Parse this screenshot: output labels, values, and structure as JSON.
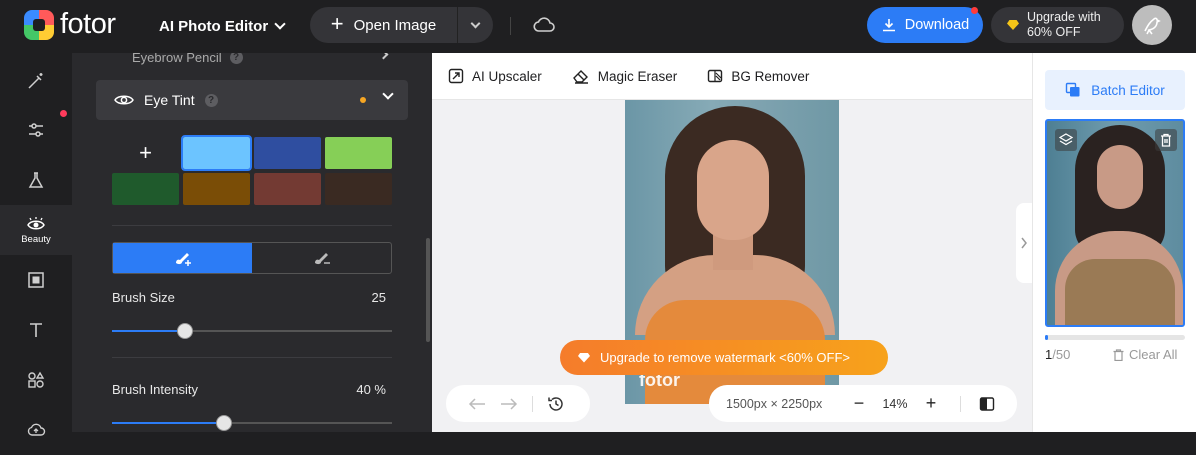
{
  "app": {
    "logo_text": "fotor",
    "menu_title": "AI Photo Editor",
    "open_image_label": "Open Image",
    "download_label": "Download",
    "upgrade_line1": "Upgrade with",
    "upgrade_line2": "60% OFF"
  },
  "rail": {
    "items": [
      {
        "icon": "magic-wand-icon",
        "label": ""
      },
      {
        "icon": "adjust-sliders-icon",
        "label": ""
      },
      {
        "icon": "flask-effects-icon",
        "label": ""
      },
      {
        "icon": "eye-beauty-icon",
        "label": "Beauty",
        "active": true
      },
      {
        "icon": "frame-icon",
        "label": ""
      },
      {
        "icon": "text-icon",
        "label": ""
      },
      {
        "icon": "elements-shapes-icon",
        "label": ""
      },
      {
        "icon": "cloud-upload-icon",
        "label": ""
      }
    ]
  },
  "panel": {
    "prev_section_label": "Eyebrow Pencil",
    "section_title": "Eye Tint",
    "add_label": "+",
    "swatches": [
      "#6cc4ff",
      "#2f4ea0",
      "#86cf57",
      "#1f5a2c",
      "#7a4d06",
      "#733a33",
      "#3a2a22"
    ],
    "selected_swatch": "#6cc4ff",
    "brush_size_label": "Brush Size",
    "brush_size_value": "25",
    "brush_size_fraction": 0.26,
    "brush_intensity_label": "Brush Intensity",
    "brush_intensity_value": "40 %",
    "brush_intensity_fraction": 0.4
  },
  "toolbar": {
    "ai_upscaler": "AI Upscaler",
    "magic_eraser": "Magic Eraser",
    "bg_remover": "BG Remover"
  },
  "canvas": {
    "watermark": "fotor",
    "promo_text": "Upgrade to remove watermark <60% OFF>",
    "dimensions": "1500px × 2250px",
    "zoom": "14%"
  },
  "right": {
    "batch_editor": "Batch Editor",
    "count_current": "1",
    "count_total": "/50",
    "clear_all": "Clear All",
    "progress_fraction": 0.02
  },
  "colors": {
    "accent": "#2c7cf6",
    "promo_start": "#f57c2b",
    "promo_end": "#f7a21b"
  }
}
